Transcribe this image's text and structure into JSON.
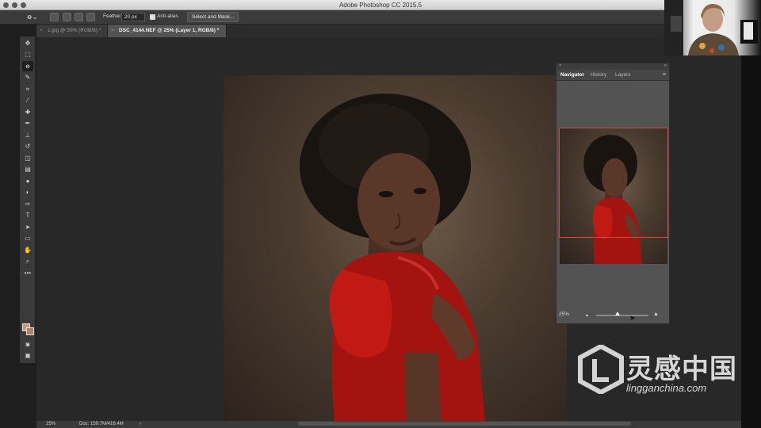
{
  "window": {
    "title": "Adobe Photoshop CC 2015.5"
  },
  "options_bar": {
    "feather_label": "Feather:",
    "feather_value": "20 px",
    "antialias_label": "Anti-alias",
    "select_mask_button": "Select and Mask..."
  },
  "tabs": [
    {
      "label": "1.jpg @ 50% (RGB/8) *",
      "active": false
    },
    {
      "label": "DSC_4144.NEF @ 25% (Layer 1, RGB/8) *",
      "active": true
    }
  ],
  "toolbar": {
    "tools": [
      "move-icon",
      "marquee-icon",
      "lasso-icon",
      "quick-select-icon",
      "crop-icon",
      "eyedropper-icon",
      "healing-icon",
      "brush-icon",
      "stamp-icon",
      "history-brush-icon",
      "eraser-icon",
      "gradient-icon",
      "blur-icon",
      "dodge-icon",
      "pen-icon",
      "type-icon",
      "path-select-icon",
      "shape-icon",
      "hand-icon",
      "zoom-icon",
      "more-icon"
    ],
    "selected_tool": "lasso-icon",
    "foreground_color": "#c89a7e",
    "background_color": "#b08060"
  },
  "navigator": {
    "tabs": [
      "Navigator",
      "History",
      "Layers"
    ],
    "active_tab": "Navigator",
    "zoom": "25%",
    "viewbox_color": "#e0443a"
  },
  "status_bar": {
    "zoom": "25%",
    "doc_size": "Doc: 159.7M/416.4M"
  },
  "watermark": {
    "cn_text": "灵感中国",
    "en_text": "lingganchina.com"
  }
}
